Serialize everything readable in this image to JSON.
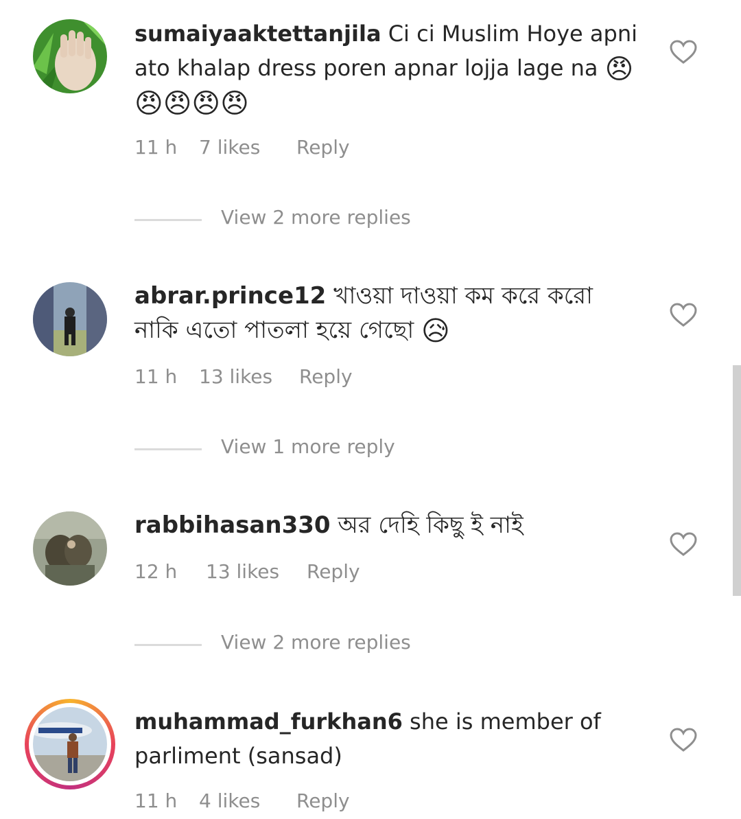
{
  "comments": [
    {
      "username": "sumaiyaaktettanjila",
      "text": "Ci ci Muslim Hoye apni ato khalap dress poren apnar lojja lage na",
      "emojis": "😠😠😠😠😠",
      "time": "11 h",
      "likes": "7 likes",
      "reply": "Reply",
      "view_more": "View 2 more replies"
    },
    {
      "username": "abrar.prince12",
      "text": "খাওয়া দাওয়া কম করে করো নাকি এতো পাতলা হয়ে গেছো",
      "emojis": "😥",
      "time": "11 h",
      "likes": "13 likes",
      "reply": "Reply",
      "view_more": "View 1 more reply"
    },
    {
      "username": "rabbihasan330",
      "text": "অর দেহি কিছু ই নাই",
      "time": "12 h",
      "likes": "13 likes",
      "reply": "Reply",
      "view_more": "View 2 more replies"
    },
    {
      "username": "muhammad_furkhan6",
      "text": "she is member of parliment (sansad)",
      "time": "11 h",
      "likes": "4 likes",
      "reply": "Reply"
    }
  ],
  "colors": {
    "text": "#262626",
    "meta": "#8e8e8e",
    "divider": "#dbdbdb",
    "story_ring": "#e8435a"
  },
  "icons": {
    "like": "heart-outline-icon"
  }
}
